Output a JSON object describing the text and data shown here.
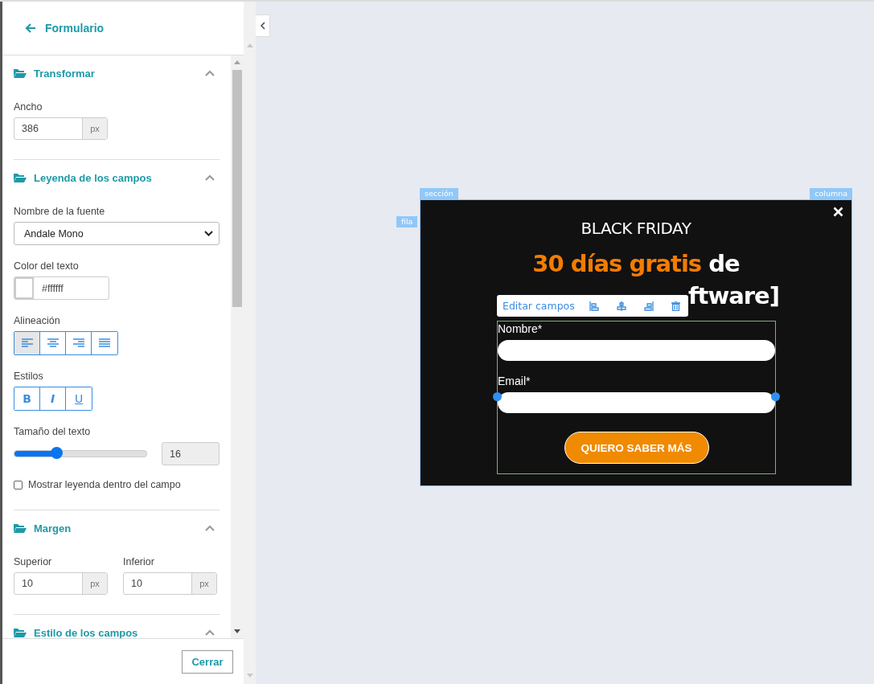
{
  "panel": {
    "title": "Formulario",
    "sections": [
      {
        "title": "Transformar",
        "expanded": true,
        "controls": [
          {
            "kind": "unit_input",
            "label": "Ancho",
            "value": "386",
            "unit": "px"
          }
        ]
      },
      {
        "title": "Leyenda de los campos",
        "expanded": true,
        "controls": [
          {
            "kind": "select",
            "label": "Nombre de la fuente",
            "value": "Andale Mono"
          },
          {
            "kind": "color",
            "label": "Color del texto",
            "value": "#ffffff",
            "color": "#ffffff"
          },
          {
            "kind": "align_group",
            "label": "Alineación",
            "options": [
              {
                "kind": "left",
                "selected": true
              },
              {
                "kind": "center",
                "selected": false
              },
              {
                "kind": "right",
                "selected": false
              },
              {
                "kind": "justify",
                "selected": false
              }
            ]
          },
          {
            "kind": "style_group",
            "label": "Estilos",
            "options": [
              {
                "kind": "bold",
                "text": "B",
                "selected": false
              },
              {
                "kind": "italic",
                "text": "I",
                "selected": false
              },
              {
                "kind": "underline",
                "text": "U",
                "selected": false
              }
            ]
          },
          {
            "kind": "slider",
            "label": "Tamaño del texto",
            "level": 0.32,
            "value": "16"
          },
          {
            "kind": "checkbox",
            "label": "Mostrar leyenda dentro del campo",
            "checked": false
          }
        ]
      },
      {
        "title": "Margen",
        "expanded": true,
        "controls": [
          {
            "kind": "unit_pair",
            "fields": [
              {
                "label": "Superior",
                "value": "10",
                "unit": "px"
              },
              {
                "label": "Inferior",
                "value": "10",
                "unit": "px"
              }
            ]
          }
        ]
      },
      {
        "title": "Estilo de los campos",
        "expanded": true
      }
    ],
    "close_button": "Cerrar"
  },
  "canvas": {
    "tags": {
      "section": "sección",
      "row": "fila",
      "column": "columna"
    },
    "popup": {
      "heading": "BLACK FRIDAY",
      "headline_highlight": "30 días gratis",
      "headline_rest": "de",
      "headline_line2": "ftware]",
      "toolbar": {
        "label": "Editar campos"
      },
      "fields": [
        {
          "label": "Nombre*"
        },
        {
          "label": "Email*"
        }
      ],
      "submit": "QUIERO SABER MÁS"
    }
  }
}
